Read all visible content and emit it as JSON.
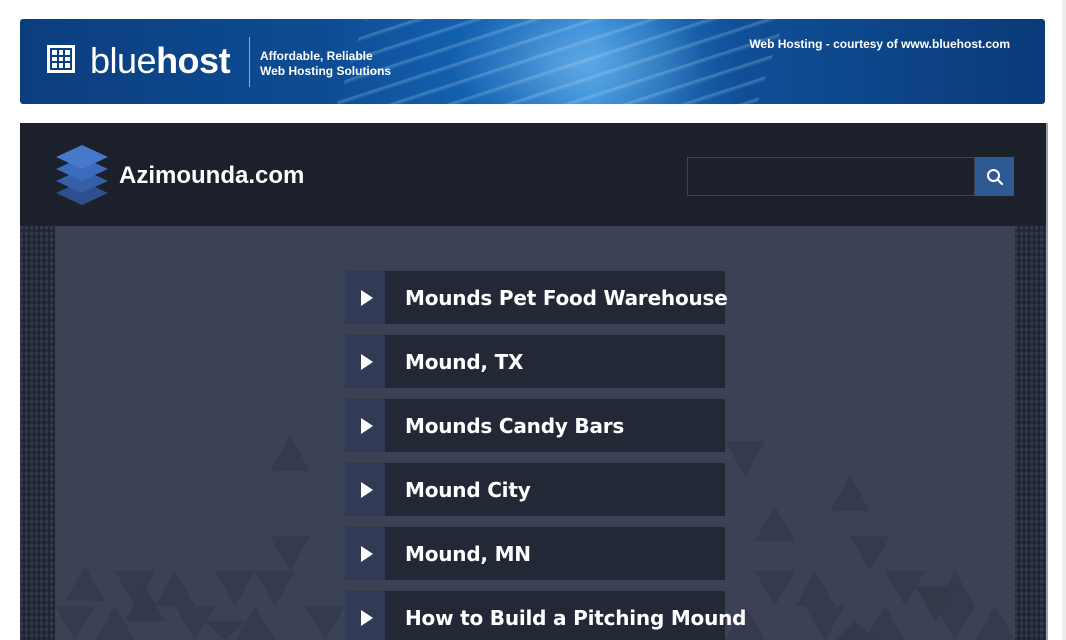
{
  "banner": {
    "brand_light": "blue",
    "brand_bold": "host",
    "tagline_line1": "Affordable, Reliable",
    "tagline_line2": "Web Hosting Solutions",
    "courtesy": "Web Hosting - courtesy of www.bluehost.com"
  },
  "site": {
    "title": "Azimounda.com",
    "search": {
      "value": "",
      "placeholder": ""
    }
  },
  "links": [
    {
      "label": "Mounds Pet Food Warehouse"
    },
    {
      "label": "Mound, TX"
    },
    {
      "label": "Mounds Candy Bars"
    },
    {
      "label": "Mound City"
    },
    {
      "label": "Mound, MN"
    },
    {
      "label": "How to Build a Pitching Mound"
    }
  ],
  "colors": {
    "banner_blue": "#0d4c94",
    "header_bg": "#1b202a",
    "content_bg": "#3b4256",
    "link_bg": "#222836",
    "arrow_box": "#313b55",
    "search_button": "#2d5a93"
  },
  "icons": [
    "bluehost-grid-icon",
    "layers-logo-icon",
    "search-icon",
    "play-arrow-icon"
  ]
}
